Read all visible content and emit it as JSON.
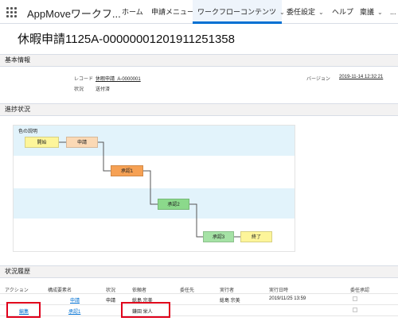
{
  "nav": {
    "app_name": "AppMoveワークフ...",
    "items": [
      {
        "label": "ホーム"
      },
      {
        "label": "申請メニュー"
      },
      {
        "label": "ワークフローコンテンツ"
      },
      {
        "label": "委任設定"
      },
      {
        "label": "ヘルプ"
      },
      {
        "label": "稟議"
      }
    ],
    "more": "..."
  },
  "page_title": "休暇申請1125A-0000000120191125​1358",
  "basic_info": {
    "header": "基本情報",
    "record_label": "レコード",
    "record_value": "休暇申請_A-0000001",
    "status_label": "状況",
    "status_value": "送付済",
    "version_label": "バージョン",
    "version_value": "2019-11-14 12:32:21"
  },
  "progress": {
    "header": "進捗状況",
    "legend": "色の説明",
    "nodes": {
      "start": "開始",
      "apply": "申請",
      "approve1": "承認1",
      "approve2": "承認2",
      "approve3": "承認3",
      "end": "終了"
    },
    "colors": {
      "start": "#fdf59a",
      "apply": "#fbd9b5",
      "approve1": "#f6a154",
      "approve2": "#8bd98b",
      "approve3": "#a5e2a5",
      "end": "#fdf59a",
      "band": "#e2f3fb"
    }
  },
  "history": {
    "header": "状況履歴",
    "columns": [
      "アクション",
      "構成要素名",
      "状況",
      "依頼者",
      "委任先",
      "実行者",
      "実行日時",
      "委任承認"
    ],
    "rows": [
      {
        "action": "",
        "element": "申請",
        "status": "申請",
        "requester": "総島 宗美",
        "delegate": "",
        "executor": "総島 宗美",
        "datetime": "2019/11/25 13:59",
        "delegated": ""
      },
      {
        "action": "編集",
        "element": "承認1",
        "status": "",
        "requester": "鎌田 栄人",
        "delegate": "",
        "executor": "",
        "datetime": "",
        "delegated": ""
      }
    ]
  }
}
